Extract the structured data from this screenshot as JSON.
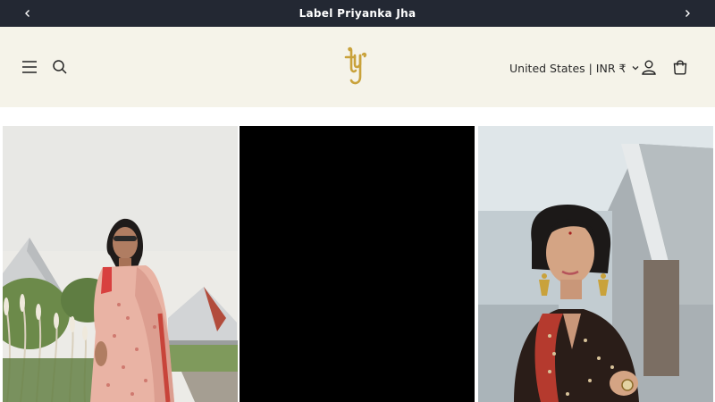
{
  "announcement": {
    "text": "Label Priyanka Jha"
  },
  "header": {
    "logo_text": "lpj",
    "country_selector": "United States | INR ₹"
  },
  "gallery": {
    "items": [
      {
        "description_icon": "saree-model-photo"
      },
      {
        "description_icon": "video-placeholder"
      },
      {
        "description_icon": "jewelry-model-photo"
      }
    ]
  },
  "colors": {
    "announcement_bg": "#232833",
    "header_bg": "#f5f3e9",
    "logo_gold": "#c9a23b"
  }
}
